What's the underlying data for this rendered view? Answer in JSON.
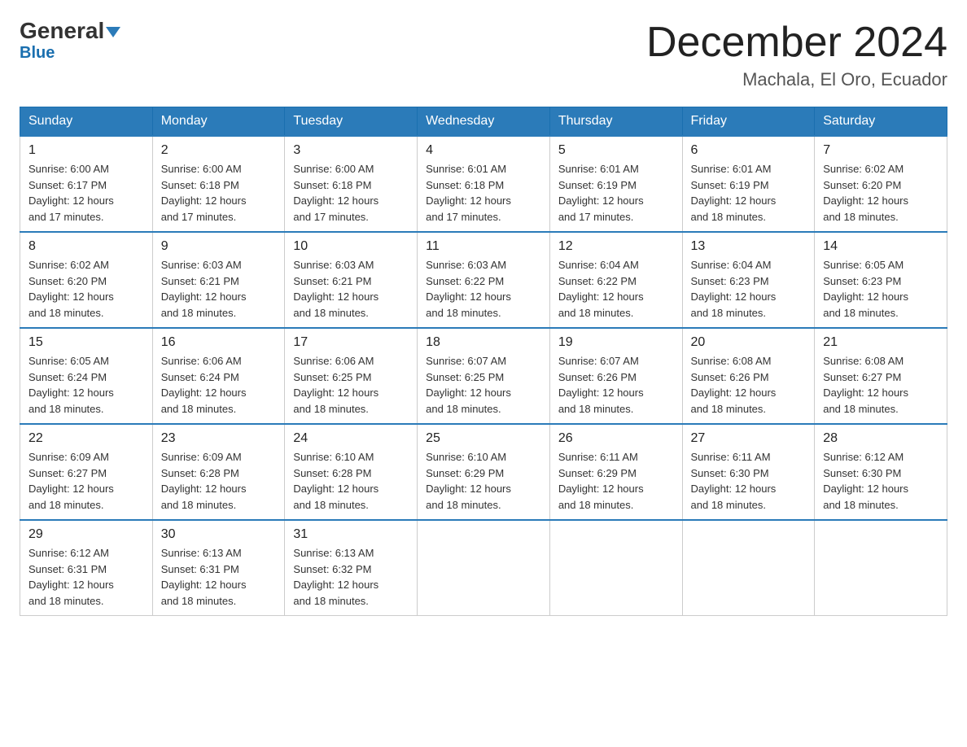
{
  "header": {
    "logo_general": "General",
    "logo_blue": "Blue",
    "month_title": "December 2024",
    "location": "Machala, El Oro, Ecuador"
  },
  "days_of_week": [
    "Sunday",
    "Monday",
    "Tuesday",
    "Wednesday",
    "Thursday",
    "Friday",
    "Saturday"
  ],
  "weeks": [
    [
      {
        "day": "1",
        "sunrise": "6:00 AM",
        "sunset": "6:17 PM",
        "daylight": "12 hours and 17 minutes."
      },
      {
        "day": "2",
        "sunrise": "6:00 AM",
        "sunset": "6:18 PM",
        "daylight": "12 hours and 17 minutes."
      },
      {
        "day": "3",
        "sunrise": "6:00 AM",
        "sunset": "6:18 PM",
        "daylight": "12 hours and 17 minutes."
      },
      {
        "day": "4",
        "sunrise": "6:01 AM",
        "sunset": "6:18 PM",
        "daylight": "12 hours and 17 minutes."
      },
      {
        "day": "5",
        "sunrise": "6:01 AM",
        "sunset": "6:19 PM",
        "daylight": "12 hours and 17 minutes."
      },
      {
        "day": "6",
        "sunrise": "6:01 AM",
        "sunset": "6:19 PM",
        "daylight": "12 hours and 18 minutes."
      },
      {
        "day": "7",
        "sunrise": "6:02 AM",
        "sunset": "6:20 PM",
        "daylight": "12 hours and 18 minutes."
      }
    ],
    [
      {
        "day": "8",
        "sunrise": "6:02 AM",
        "sunset": "6:20 PM",
        "daylight": "12 hours and 18 minutes."
      },
      {
        "day": "9",
        "sunrise": "6:03 AM",
        "sunset": "6:21 PM",
        "daylight": "12 hours and 18 minutes."
      },
      {
        "day": "10",
        "sunrise": "6:03 AM",
        "sunset": "6:21 PM",
        "daylight": "12 hours and 18 minutes."
      },
      {
        "day": "11",
        "sunrise": "6:03 AM",
        "sunset": "6:22 PM",
        "daylight": "12 hours and 18 minutes."
      },
      {
        "day": "12",
        "sunrise": "6:04 AM",
        "sunset": "6:22 PM",
        "daylight": "12 hours and 18 minutes."
      },
      {
        "day": "13",
        "sunrise": "6:04 AM",
        "sunset": "6:23 PM",
        "daylight": "12 hours and 18 minutes."
      },
      {
        "day": "14",
        "sunrise": "6:05 AM",
        "sunset": "6:23 PM",
        "daylight": "12 hours and 18 minutes."
      }
    ],
    [
      {
        "day": "15",
        "sunrise": "6:05 AM",
        "sunset": "6:24 PM",
        "daylight": "12 hours and 18 minutes."
      },
      {
        "day": "16",
        "sunrise": "6:06 AM",
        "sunset": "6:24 PM",
        "daylight": "12 hours and 18 minutes."
      },
      {
        "day": "17",
        "sunrise": "6:06 AM",
        "sunset": "6:25 PM",
        "daylight": "12 hours and 18 minutes."
      },
      {
        "day": "18",
        "sunrise": "6:07 AM",
        "sunset": "6:25 PM",
        "daylight": "12 hours and 18 minutes."
      },
      {
        "day": "19",
        "sunrise": "6:07 AM",
        "sunset": "6:26 PM",
        "daylight": "12 hours and 18 minutes."
      },
      {
        "day": "20",
        "sunrise": "6:08 AM",
        "sunset": "6:26 PM",
        "daylight": "12 hours and 18 minutes."
      },
      {
        "day": "21",
        "sunrise": "6:08 AM",
        "sunset": "6:27 PM",
        "daylight": "12 hours and 18 minutes."
      }
    ],
    [
      {
        "day": "22",
        "sunrise": "6:09 AM",
        "sunset": "6:27 PM",
        "daylight": "12 hours and 18 minutes."
      },
      {
        "day": "23",
        "sunrise": "6:09 AM",
        "sunset": "6:28 PM",
        "daylight": "12 hours and 18 minutes."
      },
      {
        "day": "24",
        "sunrise": "6:10 AM",
        "sunset": "6:28 PM",
        "daylight": "12 hours and 18 minutes."
      },
      {
        "day": "25",
        "sunrise": "6:10 AM",
        "sunset": "6:29 PM",
        "daylight": "12 hours and 18 minutes."
      },
      {
        "day": "26",
        "sunrise": "6:11 AM",
        "sunset": "6:29 PM",
        "daylight": "12 hours and 18 minutes."
      },
      {
        "day": "27",
        "sunrise": "6:11 AM",
        "sunset": "6:30 PM",
        "daylight": "12 hours and 18 minutes."
      },
      {
        "day": "28",
        "sunrise": "6:12 AM",
        "sunset": "6:30 PM",
        "daylight": "12 hours and 18 minutes."
      }
    ],
    [
      {
        "day": "29",
        "sunrise": "6:12 AM",
        "sunset": "6:31 PM",
        "daylight": "12 hours and 18 minutes."
      },
      {
        "day": "30",
        "sunrise": "6:13 AM",
        "sunset": "6:31 PM",
        "daylight": "12 hours and 18 minutes."
      },
      {
        "day": "31",
        "sunrise": "6:13 AM",
        "sunset": "6:32 PM",
        "daylight": "12 hours and 18 minutes."
      },
      null,
      null,
      null,
      null
    ]
  ],
  "labels": {
    "sunrise": "Sunrise:",
    "sunset": "Sunset:",
    "daylight": "Daylight:"
  }
}
